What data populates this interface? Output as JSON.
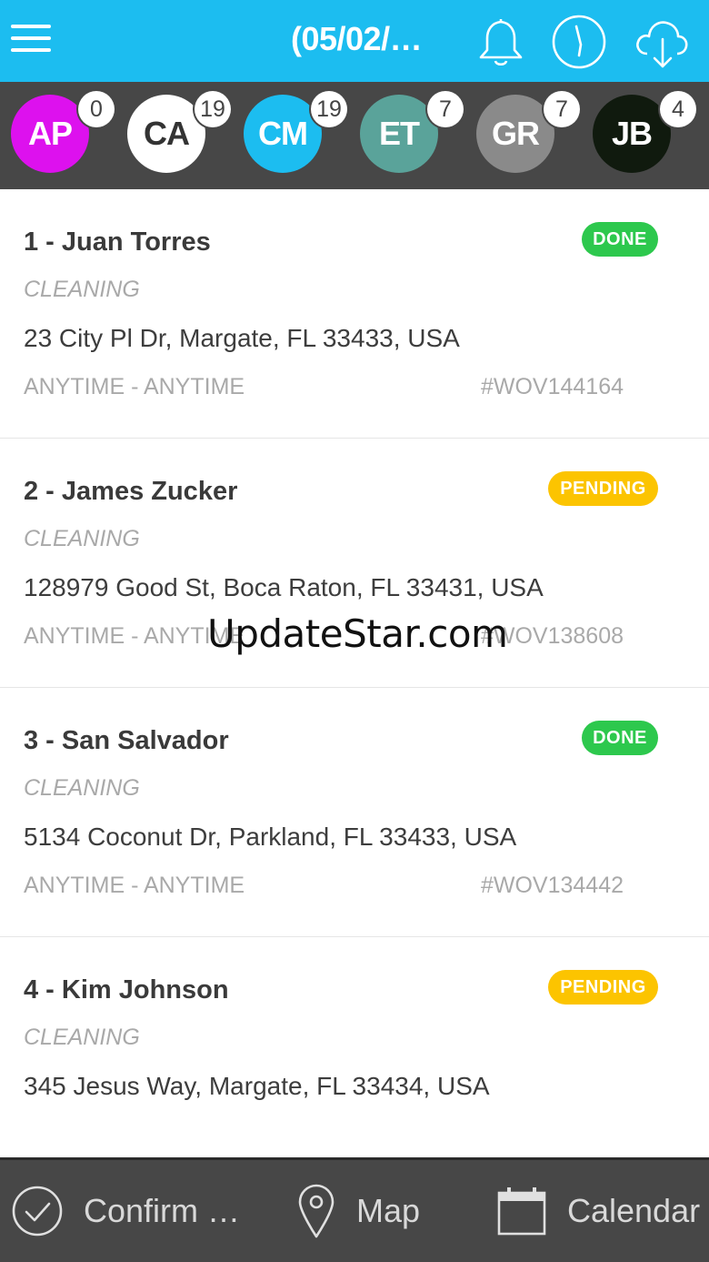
{
  "header": {
    "title": "(05/02/…",
    "icons": [
      "menu-icon",
      "bell-icon",
      "clock-icon",
      "cloud-download-icon"
    ],
    "background": "#1cbdf0"
  },
  "technicians": [
    {
      "initials": "AP",
      "count": "0",
      "color": "#dd11ee",
      "text_color": "#ffffff"
    },
    {
      "initials": "CA",
      "count": "19",
      "color": "#ffffff",
      "text_color": "#333333"
    },
    {
      "initials": "CM",
      "count": "19",
      "color": "#1cbdf0",
      "text_color": "#ffffff"
    },
    {
      "initials": "ET",
      "count": "7",
      "color": "#5aa39a",
      "text_color": "#ffffff"
    },
    {
      "initials": "GR",
      "count": "7",
      "color": "#8a8a8a",
      "text_color": "#ffffff"
    },
    {
      "initials": "JB",
      "count": "4",
      "color": "#101a0e",
      "text_color": "#ffffff"
    }
  ],
  "jobs": [
    {
      "title": "1 - Juan Torres",
      "status": "DONE",
      "type": "CLEANING",
      "address": "23 City Pl Dr, Margate, FL 33433, USA",
      "time": "ANYTIME - ANYTIME",
      "id": "#WOV144164"
    },
    {
      "title": "2 - James Zucker",
      "status": "PENDING",
      "type": "CLEANING",
      "address": "128979 Good St, Boca Raton, FL 33431, USA",
      "time": "ANYTIME - ANYTIME",
      "id": "#WOV138608"
    },
    {
      "title": "3 - San Salvador",
      "status": "DONE",
      "type": "CLEANING",
      "address": "5134 Coconut Dr, Parkland, FL 33433, USA",
      "time": "ANYTIME - ANYTIME",
      "id": "#WOV134442"
    },
    {
      "title": "4 - Kim Johnson",
      "status": "PENDING",
      "type": "CLEANING",
      "address": "345 Jesus Way, Margate, FL 33434, USA"
    }
  ],
  "status_colors": {
    "DONE": "#2dc84d",
    "PENDING": "#fcc400"
  },
  "watermark": "UpdateStar.com",
  "bottom_nav": {
    "confirm_label": "Confirm …",
    "map_label": "Map",
    "calendar_label": "Calendar"
  }
}
